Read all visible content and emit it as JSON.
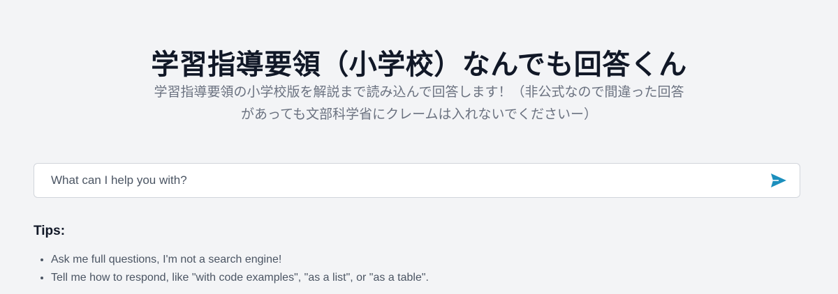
{
  "header": {
    "title": "学習指導要領（小学校）なんでも回答くん",
    "subtitle": "学習指導要領の小学校版を解説まで読み込んで回答します！（非公式なので間違った回答があっても文部科学省にクレームは入れないでくださいー）"
  },
  "search": {
    "placeholder": "What can I help you with?",
    "value": "",
    "send_icon": "send-icon",
    "accent_color": "#1c8fbd"
  },
  "tips": {
    "heading": "Tips:",
    "items": [
      "Ask me full questions, I'm not a search engine!",
      "Tell me how to respond, like \"with code examples\", \"as a list\", or \"as a table\"."
    ]
  }
}
